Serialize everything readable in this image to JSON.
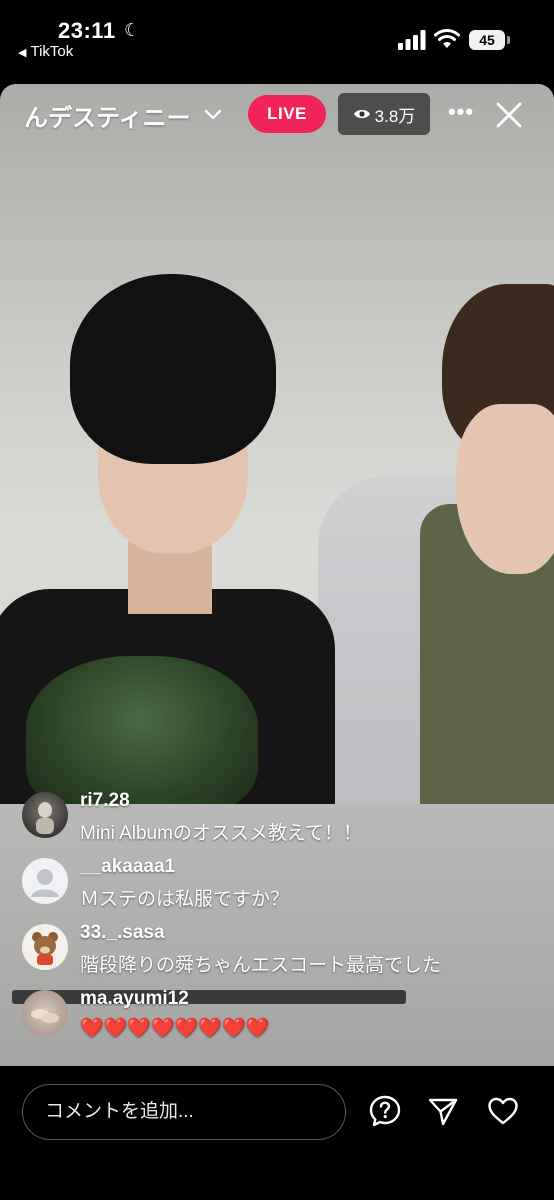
{
  "status_bar": {
    "time": "23:11",
    "back_app": "TikTok",
    "battery": "45"
  },
  "live": {
    "host_name": "んデスティニー",
    "live_badge": "LIVE",
    "viewers": "3.8万",
    "accent_color": "#f1245a"
  },
  "comments": [
    {
      "username": "ri7.28",
      "message": "Mini Albumのオススメ教えて！！"
    },
    {
      "username": "__akaaaa1",
      "message": "Ｍステのは私服ですか？"
    },
    {
      "username": "33._.sasa",
      "message": "階段降りの舜ちゃんエスコート最高でした"
    },
    {
      "username": "ma.ayumi12",
      "message": "❤️❤️❤️❤️❤️❤️❤️❤️"
    }
  ],
  "bottom_bar": {
    "placeholder": "コメントを追加...",
    "icons": [
      "question-icon",
      "share-icon",
      "heart-icon"
    ]
  }
}
